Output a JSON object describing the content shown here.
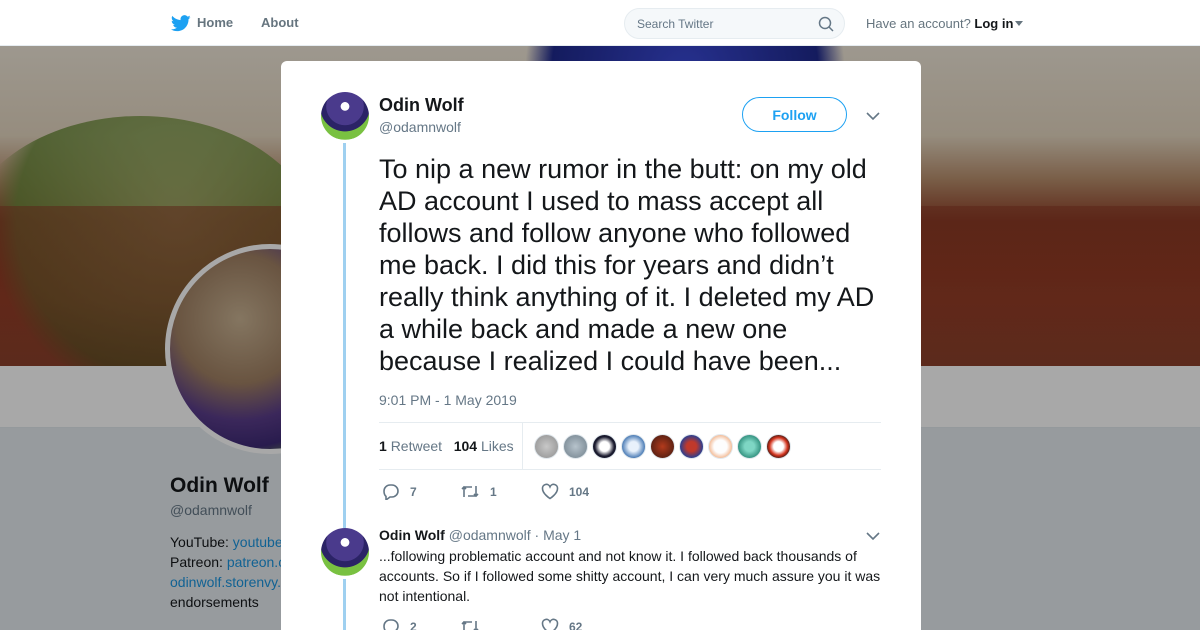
{
  "nav": {
    "home_label": "Home",
    "about_label": "About",
    "search_placeholder": "Search Twitter",
    "account_prompt": "Have an account?",
    "login_label": "Log in"
  },
  "profile": {
    "name": "Odin Wolf",
    "handle": "@odamnwolf",
    "bio": [
      {
        "prefix": "YouTube: ",
        "link": "youtube"
      },
      {
        "prefix": "Patreon: ",
        "link": "patreon.c"
      },
      {
        "prefix": "",
        "link": "odinwolf.storenvy."
      },
      {
        "prefix": "endorsements",
        "link": ""
      }
    ]
  },
  "tweet": {
    "author_name": "Odin Wolf",
    "author_handle": "@odamnwolf",
    "follow_label": "Follow",
    "text": "To nip a new rumor in the butt: on my old AD account I used to mass accept all follows and follow anyone who followed me back. I did this for years and didn’t really think anything of it. I deleted my AD a while back and made a new one because I realized I could have been...",
    "timestamp": "9:01 PM - 1 May 2019",
    "retweet_count": "1",
    "retweet_label": "Retweet",
    "like_count": "104",
    "like_label": "Likes",
    "actions": {
      "replies": "7",
      "retweets": "1",
      "likes": "104"
    }
  },
  "reply": {
    "author_name": "Odin Wolf",
    "author_handle": "@odamnwolf",
    "date": "· May 1",
    "text": "...following problematic account and not know it. I followed back thousands of accounts. So if I followed some shitty account, I can very much assure you it was not intentional.",
    "actions": {
      "replies": "2",
      "retweets": "",
      "likes": "62"
    }
  },
  "colors": {
    "accent": "#1da1f2",
    "thread_line": "#9fd0f0",
    "muted_text": "#657786",
    "primary_text": "#14171a"
  },
  "likers": [
    "gray-avatar",
    "gray-blue-avatar",
    "black-white-avatar",
    "blue-white-avatar",
    "dark-red-avatar",
    "red-blue-avatar",
    "white-orange-avatar",
    "teal-avatar",
    "black-red-avatar"
  ]
}
